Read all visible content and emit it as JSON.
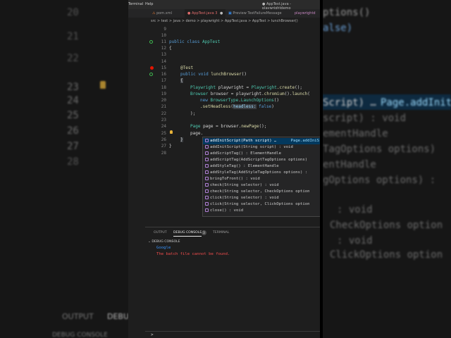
{
  "background": {
    "left_numbers": [
      "20",
      "21",
      "22",
      "23",
      "24",
      "25",
      "26",
      "27",
      "28"
    ],
    "left_tabs": [
      "OUTPUT",
      "DEBUG"
    ],
    "left_footer": "DEBUG CONSOLE",
    "right_lines": [
      "ptions()",
      "alse)",
      "Script) …",
      "script) : void",
      "ementHandle",
      "TagOptions options)",
      "entHandle",
      "gOptions options) :",
      ": void",
      "CheckOptions option",
      ": void",
      "ClickOptions option"
    ],
    "right_detail": "Page.addInit"
  },
  "menubar": {
    "items": [
      "Terminal",
      "Help"
    ],
    "title": "● AppTest.java - playwrightdemo"
  },
  "tabs": [
    {
      "label": "pom.xml",
      "active": false
    },
    {
      "label": "AppTest.java 3",
      "active": true
    },
    {
      "label": "Preview TestFailureMessage",
      "active": false
    },
    {
      "label": "playwrightd",
      "active": false
    }
  ],
  "breadcrumb": "src > test > java > demo > playwright > AppTest.java > AppTest > lunchBrowser()",
  "gutter_numbers": [
    "9",
    "10",
    "11",
    "12",
    "13",
    "14",
    "15",
    "16",
    "17",
    "18",
    "19",
    "20",
    "21",
    "22",
    "23",
    "24",
    "25",
    "26",
    "27",
    "28"
  ],
  "code": {
    "l11_kw": "public class ",
    "l11_ty": "AppTest",
    "l12": "{",
    "l15": "@Test",
    "l16_kw": "public void ",
    "l16_fn": "lunchBrowser",
    "l16_rest": "()",
    "l17": "{",
    "l18_ty": "Playwright",
    "l18_rest": " playwright = ",
    "l18_ty2": "Playwright",
    "l18_fn": ".create",
    "l18_end": "();",
    "l19_ty": "Browser",
    "l19_rest": " browser = playwright.",
    "l19_fn": "chromium",
    "l19_mid": "().",
    "l19_fn2": "launch",
    "l19_end": "(",
    "l20_kw": "new ",
    "l20_ty": "BrowserType",
    "l20_rest": ".",
    "l20_ty2": "LaunchOptions",
    "l20_end": "()",
    "l21_fn": ".setHeadless",
    "l21_open": "(",
    "l21_hl": "headless:",
    "l21_kw": " false",
    "l21_end": ")",
    "l22": ");",
    "l24_ty": "Page",
    "l24_rest": " page = browser.",
    "l24_fn": "newPage",
    "l24_end": "();",
    "l25": "page.",
    "l26": "}",
    "l27": "}"
  },
  "suggestions": {
    "items": [
      "addInitScript(Path script) …",
      "addInitScript(String script) : void",
      "addScriptTag() : ElementHandle",
      "addScriptTag(AddScriptTagOptions options)",
      "addStyleTag() : ElementHandle",
      "addStyleTag(AddStyleTagOptions options) :",
      "bringToFront() : void",
      "check(String selector) : void",
      "check(String selector, CheckOptions option",
      "click(String selector) : void",
      "click(String selector, ClickOptions option",
      "close() : void"
    ],
    "detail": "Page.addIniS"
  },
  "panel": {
    "tabs": [
      "OUTPUT",
      "DEBUG CONSOLE",
      "TERMINAL"
    ],
    "badge": "3",
    "section": "DEBUG CONSOLE",
    "lines": [
      "Google",
      "The batch file cannot be found."
    ],
    "prompt": ">"
  },
  "colors": {
    "accent": "#e06c6c",
    "error": "#f14c4c",
    "info": "#3794ff"
  }
}
